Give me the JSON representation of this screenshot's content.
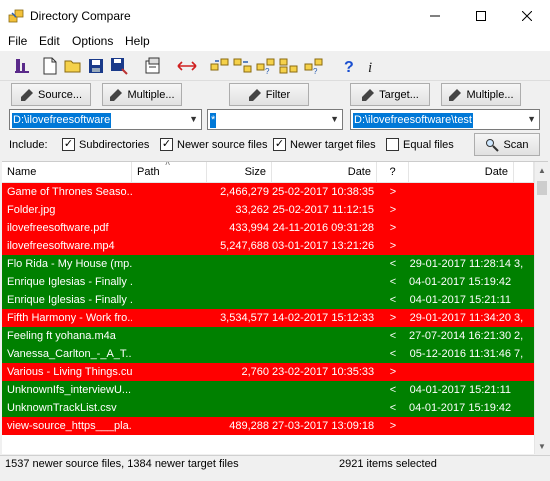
{
  "window": {
    "title": "Directory Compare"
  },
  "menu": [
    "File",
    "Edit",
    "Options",
    "Help"
  ],
  "toolbar_icons": [
    "filter-list-icon",
    "new-file-icon",
    "open-folder-icon",
    "save-icon",
    "save-as-icon",
    "properties-icon",
    "swap-arrows-icon",
    "copy-right-icon",
    "copy-left-icon",
    "copy-unknown-icon",
    "copy-both-icon",
    "copy-check-icon",
    "help-icon",
    "info-icon"
  ],
  "buttons": {
    "source": "Source...",
    "multiple_left": "Multiple...",
    "filter": "Filter",
    "target": "Target...",
    "multiple_right": "Multiple...",
    "scan": "Scan"
  },
  "combos": {
    "source_path": "D:\\ilovefreesoftware",
    "filter_mask": "*",
    "target_path": "D:\\ilovefreesoftware\\test"
  },
  "include": {
    "label": "Include:",
    "subdirectories": {
      "label": "Subdirectories",
      "checked": true
    },
    "newer_source": {
      "label": "Newer source files",
      "checked": true
    },
    "newer_target": {
      "label": "Newer target files",
      "checked": true
    },
    "equal": {
      "label": "Equal files",
      "checked": false
    }
  },
  "columns": [
    "Name",
    "Path",
    "Size",
    "Date",
    "?",
    "Date",
    ""
  ],
  "colors": {
    "source_newer": "#ff0000",
    "target_newer": "#008000"
  },
  "rows": [
    {
      "status": "red",
      "name": "Game of Thrones Seaso...",
      "size": "2,466,279",
      "date": "25-02-2017 10:38:35",
      "dir": ">",
      "tdate": "",
      "tsize": ""
    },
    {
      "status": "red",
      "name": "Folder.jpg",
      "size": "33,262",
      "date": "25-02-2017 11:12:15",
      "dir": ">",
      "tdate": "",
      "tsize": ""
    },
    {
      "status": "red",
      "name": "ilovefreesoftware.pdf",
      "size": "433,994",
      "date": "24-11-2016 09:31:28",
      "dir": ">",
      "tdate": "",
      "tsize": ""
    },
    {
      "status": "red",
      "name": "ilovefreesoftware.mp4",
      "size": "5,247,688",
      "date": "03-01-2017 13:21:26",
      "dir": ">",
      "tdate": "",
      "tsize": ""
    },
    {
      "status": "green",
      "name": "Flo Rida - My House (mp...",
      "size": "",
      "date": "",
      "dir": "<",
      "tdate": "29-01-2017 11:28:14",
      "tsize": "3,"
    },
    {
      "status": "green",
      "name": "Enrique Iglesias - Finally ...",
      "size": "",
      "date": "",
      "dir": "<",
      "tdate": "04-01-2017 15:19:42",
      "tsize": ""
    },
    {
      "status": "green",
      "name": "Enrique Iglesias - Finally ...",
      "size": "",
      "date": "",
      "dir": "<",
      "tdate": "04-01-2017 15:21:11",
      "tsize": ""
    },
    {
      "status": "red",
      "name": "Fifth Harmony - Work fro...",
      "size": "3,534,577",
      "date": "14-02-2017 15:12:33",
      "dir": ">",
      "tdate": "29-01-2017 11:34:20",
      "tsize": "3,"
    },
    {
      "status": "green",
      "name": "Feeling ft yohana.m4a",
      "size": "",
      "date": "",
      "dir": "<",
      "tdate": "27-07-2014 16:21:30",
      "tsize": "2,"
    },
    {
      "status": "green",
      "name": "Vanessa_Carlton_-_A_T...",
      "size": "",
      "date": "",
      "dir": "<",
      "tdate": "05-12-2016 11:31:46",
      "tsize": "7,"
    },
    {
      "status": "red",
      "name": "Various - Living Things.cue",
      "size": "2,760",
      "date": "23-02-2017 10:35:33",
      "dir": ">",
      "tdate": "",
      "tsize": ""
    },
    {
      "status": "green",
      "name": "UnknownIfs_interviewU...",
      "size": "",
      "date": "",
      "dir": "<",
      "tdate": "04-01-2017 15:21:11",
      "tsize": ""
    },
    {
      "status": "green",
      "name": "UnknownTrackList.csv",
      "size": "",
      "date": "",
      "dir": "<",
      "tdate": "04-01-2017 15:19:42",
      "tsize": ""
    },
    {
      "status": "red",
      "name": "view-source_https___pla...",
      "size": "489,288",
      "date": "27-03-2017 13:09:18",
      "dir": ">",
      "tdate": "",
      "tsize": ""
    }
  ],
  "status": {
    "left": "1537 newer source files, 1384 newer target files",
    "right": "2921 items selected"
  }
}
